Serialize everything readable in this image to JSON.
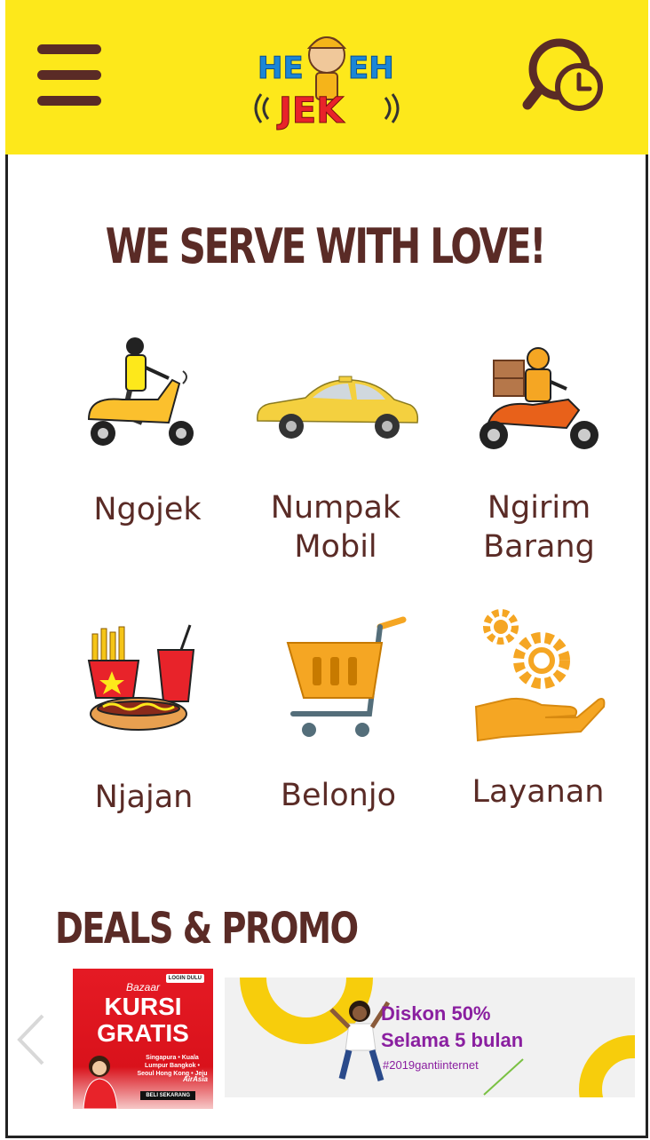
{
  "header": {
    "logo_text": "HEYEH JEK",
    "menu_icon": "hamburger-menu-icon",
    "history_icon": "search-history-icon"
  },
  "headline": "WE SERVE WITH LOVE!",
  "services": [
    {
      "label": "Ngojek",
      "icon": "scooter-rider-icon"
    },
    {
      "label": "Numpak\nMobil",
      "icon": "car-icon"
    },
    {
      "label": "Ngirim\nBarang",
      "icon": "delivery-bike-icon"
    },
    {
      "label": "Njajan",
      "icon": "fast-food-icon"
    },
    {
      "label": "Belonjo",
      "icon": "shopping-cart-icon"
    },
    {
      "label": "Layanan",
      "icon": "gear-hand-icon"
    }
  ],
  "deals": {
    "title": "DEALS & PROMO",
    "prev_icon": "chevron-left-icon",
    "promos": [
      {
        "bazaar": "Bazaar",
        "headline": "KURSI GRATIS",
        "badge": "LOGIN DULU",
        "destinations": "Singapura • Kuala Lumpur Bangkok • Seoul Hong Kong • Jeju",
        "cta": "BELI SEKARANG",
        "brand": "AirAsia"
      },
      {
        "line1": "Diskon 50%",
        "line2": "Selama 5 bulan",
        "hashtag": "#2019gantiinternet"
      }
    ]
  },
  "colors": {
    "header_bg": "#fde81b",
    "brand_brown": "#5a2b26",
    "accent_orange": "#f5a623"
  }
}
